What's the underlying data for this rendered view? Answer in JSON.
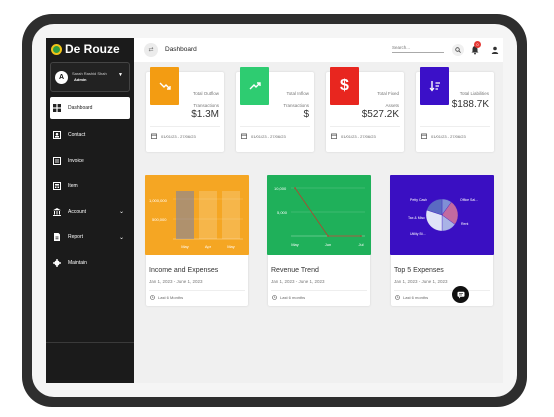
{
  "app": {
    "name": "De Rouze"
  },
  "user": {
    "name": "Sarah Rashid Shah",
    "role": "Admin",
    "avatar_letter": "A"
  },
  "sidebar": {
    "items": [
      {
        "label": "Dashboard",
        "icon": "dashboard-icon"
      },
      {
        "label": "Contact",
        "icon": "contact-icon"
      },
      {
        "label": "Invoice",
        "icon": "invoice-icon"
      },
      {
        "label": "Item",
        "icon": "item-icon"
      },
      {
        "label": "Account",
        "icon": "bank-icon",
        "expandable": true
      },
      {
        "label": "Report",
        "icon": "report-icon",
        "expandable": true
      },
      {
        "label": "Maintain",
        "icon": "gear-icon"
      }
    ]
  },
  "topbar": {
    "title": "Dashboard",
    "search_placeholder": "Search...",
    "notification_count": "0"
  },
  "stats": [
    {
      "label_line1": "Total Outflow",
      "label_line2": "Transactions",
      "value": "$1.3M",
      "date": "01/01/23 - 27/06/23",
      "color": "#f39c12"
    },
    {
      "label_line1": "Total Inflow",
      "label_line2": "Transactions",
      "value": "$",
      "date": "01/01/23 - 27/06/23",
      "color": "#2ecc71"
    },
    {
      "label_line1": "Total Fixed",
      "label_line2": "Assets",
      "value": "$527.2K",
      "date": "01/01/23 - 27/06/23",
      "color": "#e8261f"
    },
    {
      "label_line1": "Total Liabilities",
      "label_line2": "",
      "value": "$188.7K",
      "date": "01/01/23 - 27/06/23",
      "color": "#3b10c8"
    }
  ],
  "charts": [
    {
      "title": "Income and Expenses",
      "subtitle": "Jan 1, 2023 - June 1, 2023",
      "footer": "Last 6 Months",
      "color": "#f5a623"
    },
    {
      "title": "Revenue Trend",
      "subtitle": "Jan 1, 2023 - June 1, 2023",
      "footer": "Last 6 months",
      "color": "#1fb05a"
    },
    {
      "title": "Top 5 Expenses",
      "subtitle": "Jan 1, 2023 - June 1, 2023",
      "footer": "Last 6 months",
      "color": "#3a0fc2"
    }
  ],
  "chart_data": [
    {
      "type": "bar",
      "categories": [
        "May",
        "Apr",
        "May"
      ],
      "y_ticks": [
        "1,000,000",
        "500,000"
      ],
      "series": [
        {
          "values": [
            1200000,
            1200000,
            1200000
          ]
        }
      ]
    },
    {
      "type": "line",
      "x": [
        "May",
        "Jun",
        "Jul"
      ],
      "y_ticks": [
        "10,000",
        "5,000",
        "0"
      ],
      "values": [
        10000,
        0,
        0
      ]
    },
    {
      "type": "pie",
      "labels": [
        "Petty Cash",
        "Office Sal...",
        "Tax & Misc",
        "Rent",
        "Utility Bi..."
      ],
      "values": [
        10,
        25,
        15,
        30,
        20
      ]
    }
  ]
}
